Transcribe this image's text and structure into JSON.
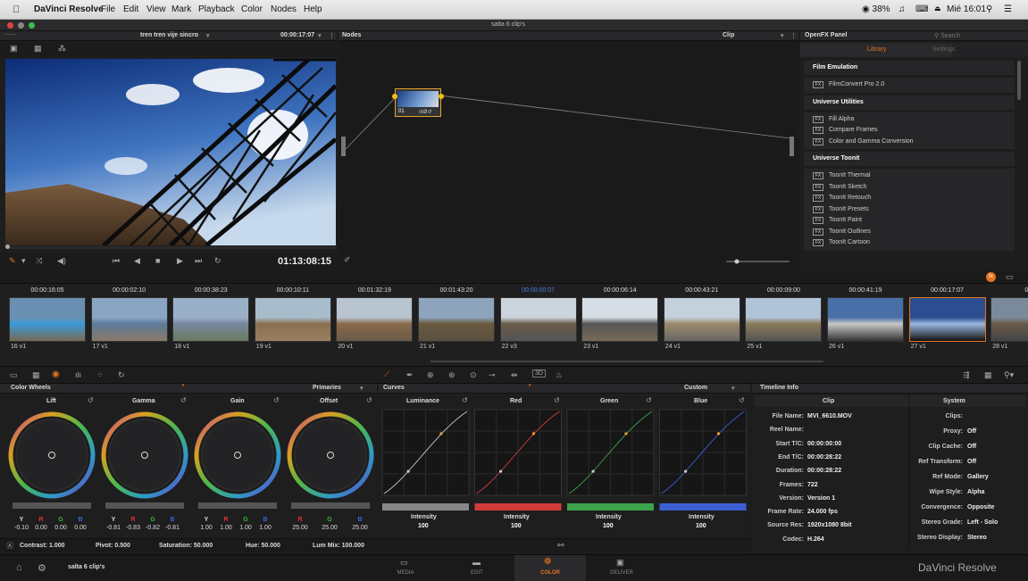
{
  "menubar": {
    "app": "DaVinci Resolve",
    "items": [
      "File",
      "Edit",
      "View",
      "Mark",
      "Playback",
      "Color",
      "Nodes",
      "Help"
    ],
    "battery": "38%",
    "clock": "Mié 16:01"
  },
  "window": {
    "title": "salta 6 clip's"
  },
  "viewer": {
    "clip_name": "tren tren vije sincro",
    "timecode_top": "00:00:17:07",
    "timecode": "01:13:08:15"
  },
  "nodes": {
    "title": "Nodes",
    "mode": "Clip",
    "node_label": "01"
  },
  "openfx": {
    "title": "OpenFX Panel",
    "search_placeholder": "Search",
    "tabs": [
      "Library",
      "Settings"
    ],
    "groups": [
      {
        "name": "Film Emulation",
        "items": [
          "FilmConvert Pro 2.0"
        ]
      },
      {
        "name": "Universe Utilities",
        "items": [
          "Fill Alpha",
          "Compare Frames",
          "Color and Gamma Conversion"
        ]
      },
      {
        "name": "Universe Toonit",
        "items": [
          "ToonIt Thermal",
          "ToonIt Sketch",
          "ToonIt Retouch",
          "ToonIt Presets",
          "ToonIt Paint",
          "ToonIt Outlines",
          "ToonIt Cartoon"
        ]
      }
    ]
  },
  "timeline": {
    "clips": [
      {
        "tc": "00:00:16:05",
        "label": "16  v1"
      },
      {
        "tc": "00:00:02:10",
        "label": "17  v1"
      },
      {
        "tc": "00:00:38:23",
        "label": "18  v1"
      },
      {
        "tc": "00:00:10:11",
        "label": "19  v1"
      },
      {
        "tc": "00:01:32:19",
        "label": "20  v1"
      },
      {
        "tc": "00:01:43:20",
        "label": "21  v1"
      },
      {
        "tc": "00:00:00:07",
        "label": "22  v3"
      },
      {
        "tc": "00:00:06:14",
        "label": "23  v1"
      },
      {
        "tc": "00:00:43:21",
        "label": "24  v1"
      },
      {
        "tc": "00:00:09:00",
        "label": "25  v1"
      },
      {
        "tc": "00:00:41:19",
        "label": "26  v1"
      },
      {
        "tc": "00:00:17:07",
        "label": "27  v1"
      },
      {
        "tc": "00:",
        "label": "28  v1"
      }
    ]
  },
  "wheels": {
    "title": "Color Wheels",
    "mode": "Primaries",
    "names": [
      "Lift",
      "Gamma",
      "Gain",
      "Offset"
    ],
    "ylabels": [
      "Y",
      "R",
      "G",
      "B"
    ],
    "olabels": [
      "R",
      "G",
      "B"
    ],
    "lift": [
      "-0.10",
      "0.00",
      "0.00",
      "0.00"
    ],
    "gamma": [
      "-0.81",
      "-0.83",
      "-0.82",
      "-0.81"
    ],
    "gain": [
      "1.00",
      "1.00",
      "1.00",
      "1.00"
    ],
    "offset": [
      "25.00",
      "25.00",
      "25.00"
    ],
    "contrast": "Contrast: 1.000",
    "pivot": "Pivot: 0.500",
    "saturation": "Saturation: 50.000",
    "hue": "Hue: 50.000",
    "lummix": "Lum Mix: 100.000"
  },
  "curves": {
    "title": "Curves",
    "mode": "Custom",
    "channels": [
      "Luminance",
      "Red",
      "Green",
      "Blue"
    ],
    "intensity_label": "Intensity",
    "intensity_value": "100",
    "colors": {
      "luminance": "#cccccc",
      "red": "#d33b3b",
      "green": "#3ca34a",
      "blue": "#3b5fd3"
    }
  },
  "timeline_info": {
    "title": "Timeline Info",
    "clip_header": "Clip",
    "system_header": "System",
    "clip": [
      [
        "File Name:",
        "MVI_6610.MOV"
      ],
      [
        "Reel Name:",
        ""
      ],
      [
        "Start T/C:",
        "00:00:00:00"
      ],
      [
        "End T/C:",
        "00:00:28:22"
      ],
      [
        "Duration:",
        "00:00:28:22"
      ],
      [
        "Frames:",
        "722"
      ],
      [
        "Version:",
        "Version 1"
      ],
      [
        "Frame Rate:",
        "24.000 fps"
      ],
      [
        "Source Res:",
        "1920x1080 8bit"
      ],
      [
        "Codec:",
        "H.264"
      ]
    ],
    "system": [
      [
        "Clips:",
        ""
      ],
      [
        "Proxy:",
        "Off"
      ],
      [
        "Clip Cache:",
        "Off"
      ],
      [
        "Ref Transform:",
        "Off"
      ],
      [
        "Ref Mode:",
        "Gallery"
      ],
      [
        "Wipe Style:",
        "Alpha"
      ],
      [
        "Convergence:",
        "Opposite"
      ],
      [
        "Stereo Grade:",
        "Left - Solo"
      ],
      [
        "Stereo Display:",
        "Stereo"
      ]
    ]
  },
  "footer": {
    "project": "salta 6 clip's",
    "pages": [
      "MEDIA",
      "EDIT",
      "COLOR",
      "DELIVER"
    ],
    "brand": "DaVinci Resolve",
    "active": "#e8731f"
  }
}
